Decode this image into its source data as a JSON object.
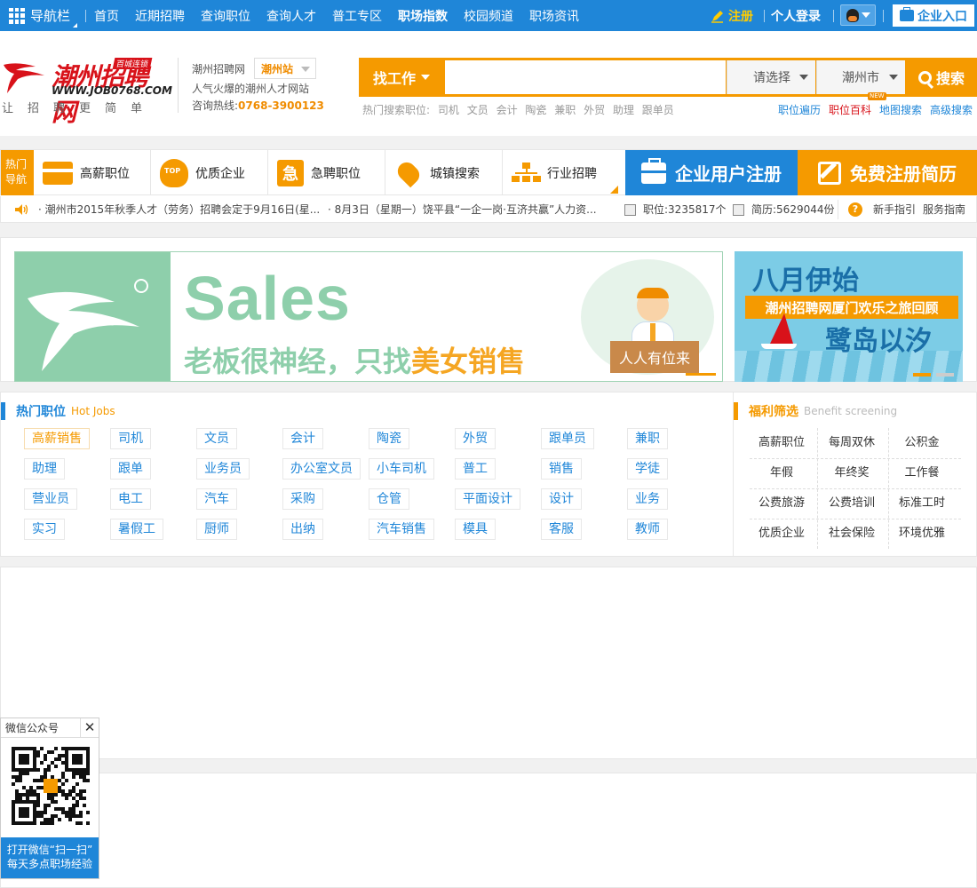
{
  "topnav": {
    "toggle_label": "导航栏",
    "items": [
      "首页",
      "近期招聘",
      "查询职位",
      "查询人才",
      "普工专区",
      "职场指数",
      "校园频道",
      "职场资讯"
    ],
    "bold_item": "职场指数",
    "register_label": "注册",
    "login_label": "个人登录",
    "enterprise_label": "企业入口"
  },
  "logo": {
    "name": "潮州招聘网",
    "badge": "百城连锁",
    "url": "WWW.JOB0768.COM",
    "slogan": "让招聘更简单"
  },
  "site": {
    "name": "潮州招聘网",
    "station": "潮州站",
    "tagline": "人气火爆的潮州人才网站",
    "hotline_label": "咨询热线:",
    "hotline": "0768-3900123"
  },
  "search": {
    "type_label": "找工作",
    "placeholder": "",
    "select_category": "请选择",
    "select_city": "潮州市",
    "button_label": "搜索",
    "hot_label": "热门搜索职位:",
    "hot_terms": [
      "司机",
      "文员",
      "会计",
      "陶瓷",
      "兼职",
      "外贸",
      "助理",
      "跟单员"
    ],
    "links": [
      "职位遍历",
      "职位百科",
      "地图搜索",
      "高级搜索"
    ],
    "new_badge": "NEW"
  },
  "categories": {
    "quick_label": "热门导航",
    "items": [
      "高薪职位",
      "优质企业",
      "急聘职位",
      "城镇搜索",
      "行业招聘"
    ],
    "urgent_glyph": "急",
    "top_glyph": "TOP",
    "enterprise_register": "企业用户注册",
    "resume_register": "免费注册简历"
  },
  "ticker": {
    "news": [
      "潮州市2015年秋季人才（劳务）招聘会定于9月16日(星...",
      "8月3日（星期一）饶平县“一企一岗·互济共赢”人力资..."
    ],
    "jobs_stat": "职位:3235817个",
    "resumes_stat": "简历:5629044份",
    "help_glyph": "?",
    "guide": "新手指引",
    "service": "服务指南"
  },
  "banner_main": {
    "headline": "Sales",
    "slogan_prefix": "老板很神经，只找",
    "slogan_highlight": "美女销售",
    "tag": "人人有位来"
  },
  "banner_side": {
    "line1": "八月伊始",
    "line2": "潮州招聘网厦门欢乐之旅回顾",
    "line3": "鹭岛以汐"
  },
  "hot_jobs": {
    "title": "热门职位",
    "subtitle": "Hot Jobs",
    "rows": [
      [
        "高薪销售",
        "司机",
        "文员",
        "会计",
        "陶瓷",
        "外贸",
        "跟单员",
        "兼职"
      ],
      [
        "助理",
        "跟单",
        "业务员",
        "办公室文员",
        "小车司机",
        "普工",
        "销售",
        "学徒"
      ],
      [
        "营业员",
        "电工",
        "汽车",
        "采购",
        "仓管",
        "平面设计",
        "设计",
        "业务"
      ],
      [
        "实习",
        "暑假工",
        "厨师",
        "出纳",
        "汽车销售",
        "模具",
        "客服",
        "教师"
      ]
    ]
  },
  "benefits": {
    "title": "福利筛选",
    "subtitle": "Benefit screening",
    "rows": [
      [
        "高薪职位",
        "每周双休",
        "公积金"
      ],
      [
        "年假",
        "年终奖",
        "工作餐"
      ],
      [
        "公费旅游",
        "公费培训",
        "标准工时"
      ],
      [
        "优质企业",
        "社会保险",
        "环境优雅"
      ]
    ]
  },
  "wechat": {
    "title": "微信公众号",
    "close_glyph": "✕",
    "line1": "打开微信“扫一扫”",
    "line2": "每天多点职场经验"
  },
  "colors": {
    "brand_blue": "#1f86d8",
    "brand_orange": "#f59a00",
    "brand_red": "#d8121a",
    "banner_green": "#8ecfab"
  }
}
